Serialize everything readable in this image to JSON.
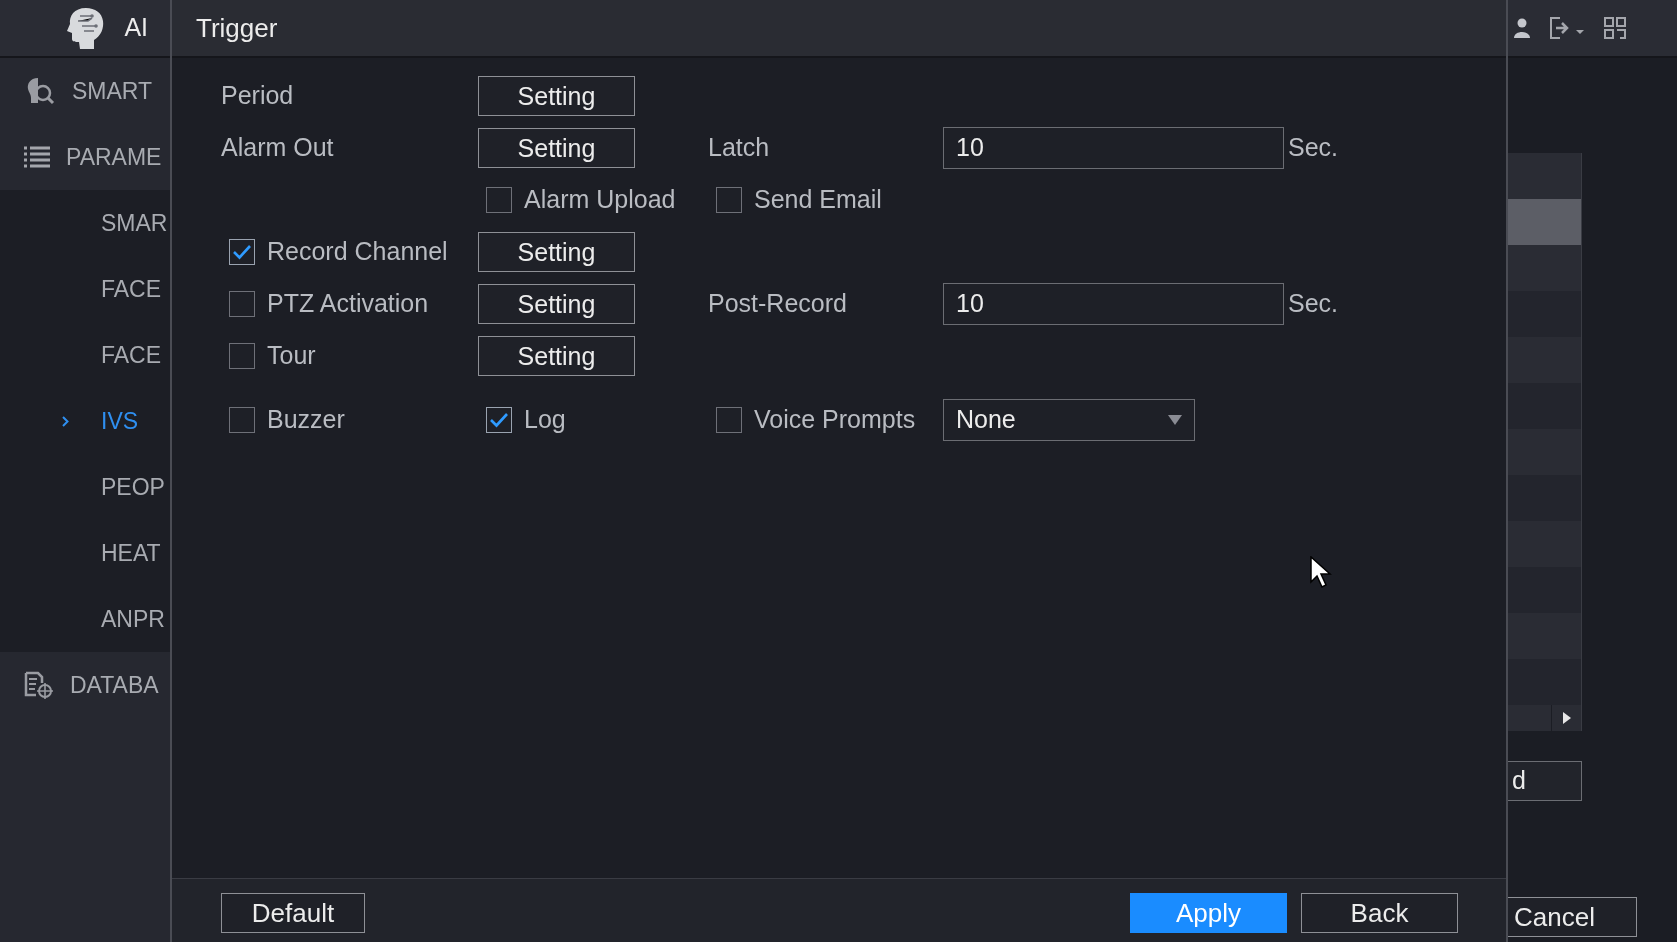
{
  "app": {
    "title": "AI"
  },
  "sidebar": {
    "sections": [
      {
        "label": "SMART"
      },
      {
        "label": "PARAME",
        "children": [
          {
            "label": "SMAR",
            "selected": false
          },
          {
            "label": "FACE",
            "selected": false
          },
          {
            "label": "FACE",
            "selected": false
          },
          {
            "label": "IVS",
            "selected": true
          },
          {
            "label": "PEOP",
            "selected": false
          },
          {
            "label": "HEAT",
            "selected": false
          },
          {
            "label": "ANPR",
            "selected": false
          }
        ]
      },
      {
        "label": "DATABA"
      }
    ]
  },
  "dialog": {
    "title": "Trigger",
    "rows": [
      {
        "main": {
          "kind": "label",
          "text": "Period"
        },
        "action": {
          "kind": "button",
          "text": "Setting"
        }
      },
      {
        "main": {
          "kind": "label",
          "text": "Alarm Out"
        },
        "action": {
          "kind": "button",
          "text": "Setting"
        },
        "extra": {
          "kind": "label",
          "text": "Latch"
        },
        "value": {
          "kind": "input",
          "text": "10"
        },
        "unit": "Sec."
      },
      {
        "action": {
          "kind": "checkbox",
          "text": "Alarm Upload",
          "checked": false
        },
        "extra": {
          "kind": "checkbox",
          "text": "Send Email",
          "checked": false
        }
      },
      {
        "main": {
          "kind": "checkbox",
          "text": "Record Channel",
          "checked": true
        },
        "action": {
          "kind": "button",
          "text": "Setting"
        }
      },
      {
        "main": {
          "kind": "checkbox",
          "text": "PTZ Activation",
          "checked": false
        },
        "action": {
          "kind": "button",
          "text": "Setting"
        },
        "extra": {
          "kind": "label",
          "text": "Post-Record"
        },
        "value": {
          "kind": "input",
          "text": "10"
        },
        "unit": "Sec."
      },
      {
        "main": {
          "kind": "checkbox",
          "text": "Tour",
          "checked": false
        },
        "action": {
          "kind": "button",
          "text": "Setting"
        }
      },
      {
        "main": {
          "kind": "checkbox",
          "text": "Buzzer",
          "checked": false
        },
        "action": {
          "kind": "checkbox",
          "text": "Log",
          "checked": true
        },
        "extra": {
          "kind": "checkbox",
          "text": "Voice Prompts",
          "checked": false
        },
        "value": {
          "kind": "select",
          "text": "None"
        }
      }
    ],
    "footer": {
      "left": [
        {
          "label": "Default",
          "kind": "normal"
        }
      ],
      "right": [
        {
          "label": "Apply",
          "kind": "primary"
        },
        {
          "label": "Back",
          "kind": "normal"
        }
      ]
    }
  },
  "background_panel": {
    "table": {
      "rows": [
        {
          "selected": false
        },
        {
          "selected": true
        },
        {
          "selected": false
        },
        {
          "selected": false
        },
        {
          "selected": false
        },
        {
          "selected": false
        },
        {
          "selected": false
        },
        {
          "selected": false
        },
        {
          "selected": false
        },
        {
          "selected": false
        },
        {
          "selected": false
        },
        {
          "selected": false
        }
      ]
    },
    "field_value": "d",
    "button": "Cancel"
  }
}
